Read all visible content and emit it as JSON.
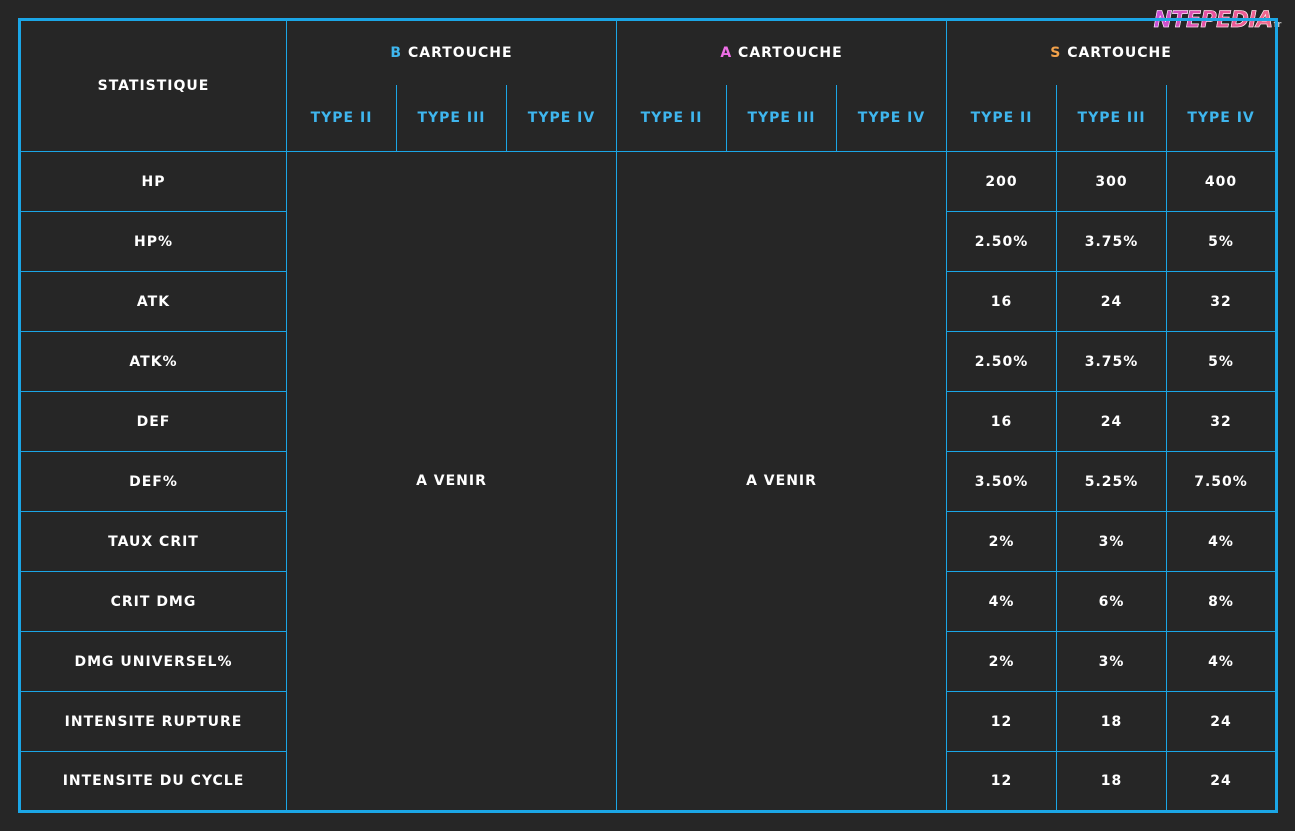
{
  "logo": {
    "text": "NTEPEDIA",
    "suffix": "fr"
  },
  "colors": {
    "background": "#262626",
    "border": "#1ba6e6",
    "type_header": "#3fb6ee",
    "grade_b": "#3fb6ee",
    "grade_a": "#ee6fe6",
    "grade_s": "#f2a14a"
  },
  "header": {
    "stat_label": "STATISTIQUE",
    "groups": [
      {
        "grade": "B",
        "label": "CARTOUCHE"
      },
      {
        "grade": "A",
        "label": "CARTOUCHE"
      },
      {
        "grade": "S",
        "label": "CARTOUCHE"
      }
    ],
    "types": [
      "TYPE II",
      "TYPE III",
      "TYPE IV"
    ]
  },
  "pending_label": "A VENIR",
  "rows": [
    {
      "stat": "HP",
      "s": [
        "200",
        "300",
        "400"
      ]
    },
    {
      "stat": "HP%",
      "s": [
        "2.50%",
        "3.75%",
        "5%"
      ]
    },
    {
      "stat": "ATK",
      "s": [
        "16",
        "24",
        "32"
      ]
    },
    {
      "stat": "ATK%",
      "s": [
        "2.50%",
        "3.75%",
        "5%"
      ]
    },
    {
      "stat": "DEF",
      "s": [
        "16",
        "24",
        "32"
      ]
    },
    {
      "stat": "DEF%",
      "s": [
        "3.50%",
        "5.25%",
        "7.50%"
      ]
    },
    {
      "stat": "TAUX CRIT",
      "s": [
        "2%",
        "3%",
        "4%"
      ]
    },
    {
      "stat": "CRIT DMG",
      "s": [
        "4%",
        "6%",
        "8%"
      ]
    },
    {
      "stat": "DMG UNIVERSEL%",
      "s": [
        "2%",
        "3%",
        "4%"
      ]
    },
    {
      "stat": "INTENSITE RUPTURE",
      "s": [
        "12",
        "18",
        "24"
      ]
    },
    {
      "stat": "INTENSITE DU CYCLE",
      "s": [
        "12",
        "18",
        "24"
      ]
    }
  ]
}
